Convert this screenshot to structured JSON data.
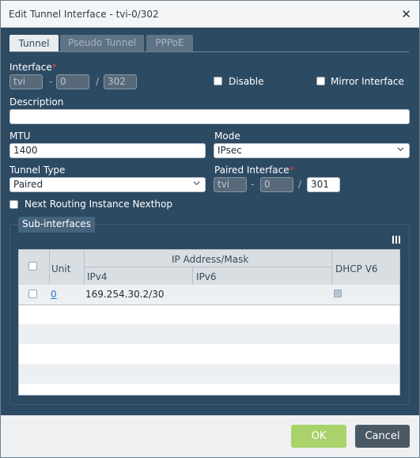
{
  "dialog": {
    "title": "Edit Tunnel Interface - tvi-0/302",
    "close_glyph": "✕"
  },
  "tabs": [
    {
      "label": "Tunnel",
      "active": true
    },
    {
      "label": "Pseudo Tunnel",
      "active": false
    },
    {
      "label": "PPPoE",
      "active": false
    }
  ],
  "interface": {
    "label": "Interface",
    "required_mark": "*",
    "prefix": "tvi",
    "mid": "0",
    "unit": "302",
    "dash": "-",
    "slash": "/"
  },
  "disable": {
    "label": "Disable",
    "checked": false
  },
  "mirror": {
    "label": "Mirror Interface",
    "checked": false
  },
  "description": {
    "label": "Description",
    "value": ""
  },
  "mtu": {
    "label": "MTU",
    "value": "1400"
  },
  "mode": {
    "label": "Mode",
    "value": "IPsec"
  },
  "tunnel_type": {
    "label": "Tunnel Type",
    "value": "Paired"
  },
  "paired_interface": {
    "label": "Paired Interface",
    "required_mark": "*",
    "prefix": "tvi",
    "mid": "0",
    "unit": "301",
    "dash": "-",
    "slash": "/"
  },
  "next_routing": {
    "label": "Next Routing Instance Nexthop",
    "checked": false
  },
  "subinterfaces": {
    "legend": "Sub-interfaces",
    "columns": {
      "unit": "Unit",
      "ip_group": "IP Address/Mask",
      "ipv4": "IPv4",
      "ipv6": "IPv6",
      "dhcp": "DHCP V6"
    },
    "rows": [
      {
        "unit": "0",
        "ipv4": "169.254.30.2/30",
        "ipv6": "",
        "dhcp_v6": false
      }
    ]
  },
  "footer": {
    "ok_label": "OK",
    "cancel_label": "Cancel"
  },
  "colors": {
    "dialog_bg": "#2d4a63",
    "ok_button": "#a9d36a",
    "cancel_button": "#4b5964",
    "required": "#e0473f",
    "link": "#2e76c6"
  }
}
